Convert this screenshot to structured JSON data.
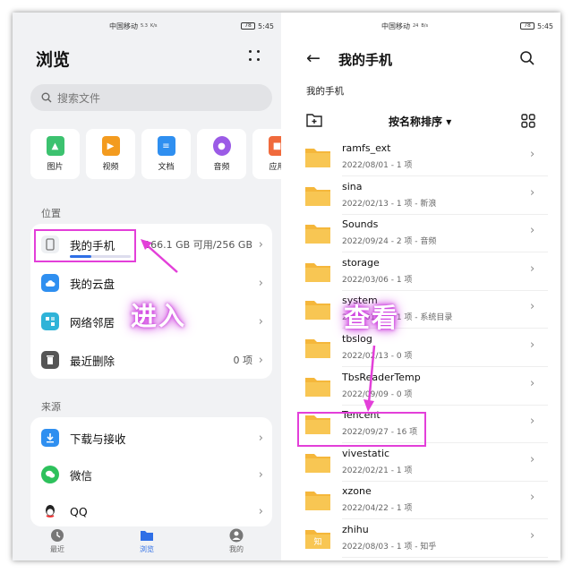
{
  "colors": {
    "accent": "#2f6fe6",
    "highlight": "#e33fd9",
    "folder": "#f5b73b",
    "arrow": "#e33fd9"
  },
  "status_left": {
    "carrier": "中国移动",
    "speed_val": "5.3",
    "speed_unit": "K/s",
    "time": "5:45",
    "battery": "78"
  },
  "status_right": {
    "carrier": "中国移动",
    "speed_val": "24",
    "speed_unit": "B/s",
    "time": "5:45",
    "battery": "78"
  },
  "browse": {
    "title": "浏览",
    "more_icon": "more-dots-icon",
    "search_placeholder": "搜索文件",
    "categories": [
      {
        "label": "图片",
        "icon": "image-icon",
        "color": "#3cc26f"
      },
      {
        "label": "视频",
        "icon": "video-icon",
        "color": "#f39b1f"
      },
      {
        "label": "文档",
        "icon": "document-icon",
        "color": "#2f8ff0"
      },
      {
        "label": "音频",
        "icon": "audio-icon",
        "color": "#9b5be6"
      },
      {
        "label": "应用",
        "icon": "app-icon",
        "color": "#f06a3c"
      }
    ],
    "location_label": "位置",
    "locations": [
      {
        "label": "我的手机",
        "value": "166.1 GB 可用/256 GB",
        "icon": "phone-icon",
        "usage_fraction": 0.35
      },
      {
        "label": "我的云盘",
        "value": "",
        "icon": "cloud-icon"
      },
      {
        "label": "网络邻居",
        "value": "",
        "icon": "network-icon"
      },
      {
        "label": "最近删除",
        "value": "0 项",
        "icon": "trash-icon"
      }
    ],
    "source_label": "来源",
    "sources": [
      {
        "label": "下载与接收",
        "icon": "download-icon"
      },
      {
        "label": "微信",
        "icon": "wechat-icon"
      },
      {
        "label": "QQ",
        "icon": "qq-icon"
      }
    ],
    "enter_label": "进入",
    "tabs": [
      {
        "label": "最近",
        "icon": "clock-icon"
      },
      {
        "label": "浏览",
        "icon": "folder-icon"
      },
      {
        "label": "我的",
        "icon": "user-icon"
      }
    ]
  },
  "phone": {
    "title": "我的手机",
    "breadcrumb": "我的手机",
    "sort_label": "按名称排序",
    "view_label": "查看",
    "folders": [
      {
        "name": "ramfs_ext",
        "meta": "2022/08/01 - 1 项"
      },
      {
        "name": "sina",
        "meta": "2022/02/13 - 1 项 - 新浪"
      },
      {
        "name": "Sounds",
        "meta": "2022/09/24 - 2 项 - 音频"
      },
      {
        "name": "storage",
        "meta": "2022/03/06 - 1 项"
      },
      {
        "name": "system",
        "meta": "2022/01/01 - 1 项 - 系统目录"
      },
      {
        "name": "tbslog",
        "meta": "2022/02/13 - 0 项"
      },
      {
        "name": "TbsReaderTemp",
        "meta": "2022/09/09 - 0 项"
      },
      {
        "name": "Tencent",
        "meta": "2022/09/27 - 16 项"
      },
      {
        "name": "vivestatic",
        "meta": "2022/02/21 - 1 项"
      },
      {
        "name": "xzone",
        "meta": "2022/04/22 - 1 项"
      },
      {
        "name": "zhihu",
        "meta": "2022/08/03 - 1 项 - 知乎"
      }
    ]
  }
}
